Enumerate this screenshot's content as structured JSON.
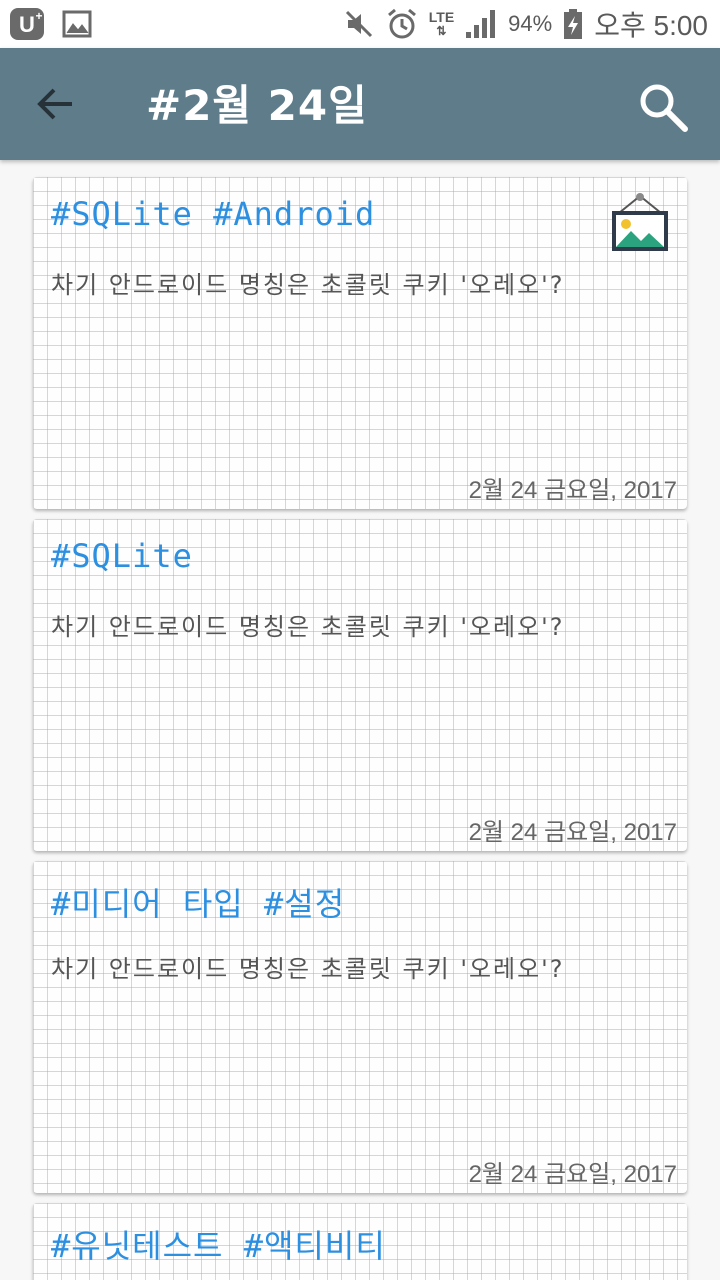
{
  "status_bar": {
    "carrier": "U+",
    "network": "LTE",
    "battery_percent": "94%",
    "time": "오후 5:00"
  },
  "app_bar": {
    "title": "#2월 24일",
    "back_icon": "arrow-left",
    "search_icon": "magnifier"
  },
  "colors": {
    "app_bar": "#5f7c8a",
    "tag_text": "#2d8fe0",
    "grid_lines": "#e18c96"
  },
  "notes": [
    {
      "tags": "#SQLite #Android",
      "body": "차기 안드로이드 명칭은 초콜릿 쿠키 '오레오'?",
      "date": "2월 24 금요일, 2017",
      "has_image": true
    },
    {
      "tags": "#SQLite",
      "body": "차기 안드로이드 명칭은 초콜릿 쿠키 '오레오'?",
      "date": "2월 24 금요일, 2017",
      "has_image": false
    },
    {
      "tags": "#미디어 타입 #설정",
      "body": "차기 안드로이드 명칭은 초콜릿 쿠키 '오레오'?",
      "date": "2월 24 금요일, 2017",
      "has_image": false
    },
    {
      "tags": "#유닛테스트 #액티비티",
      "body": "",
      "date": "",
      "has_image": false
    }
  ]
}
